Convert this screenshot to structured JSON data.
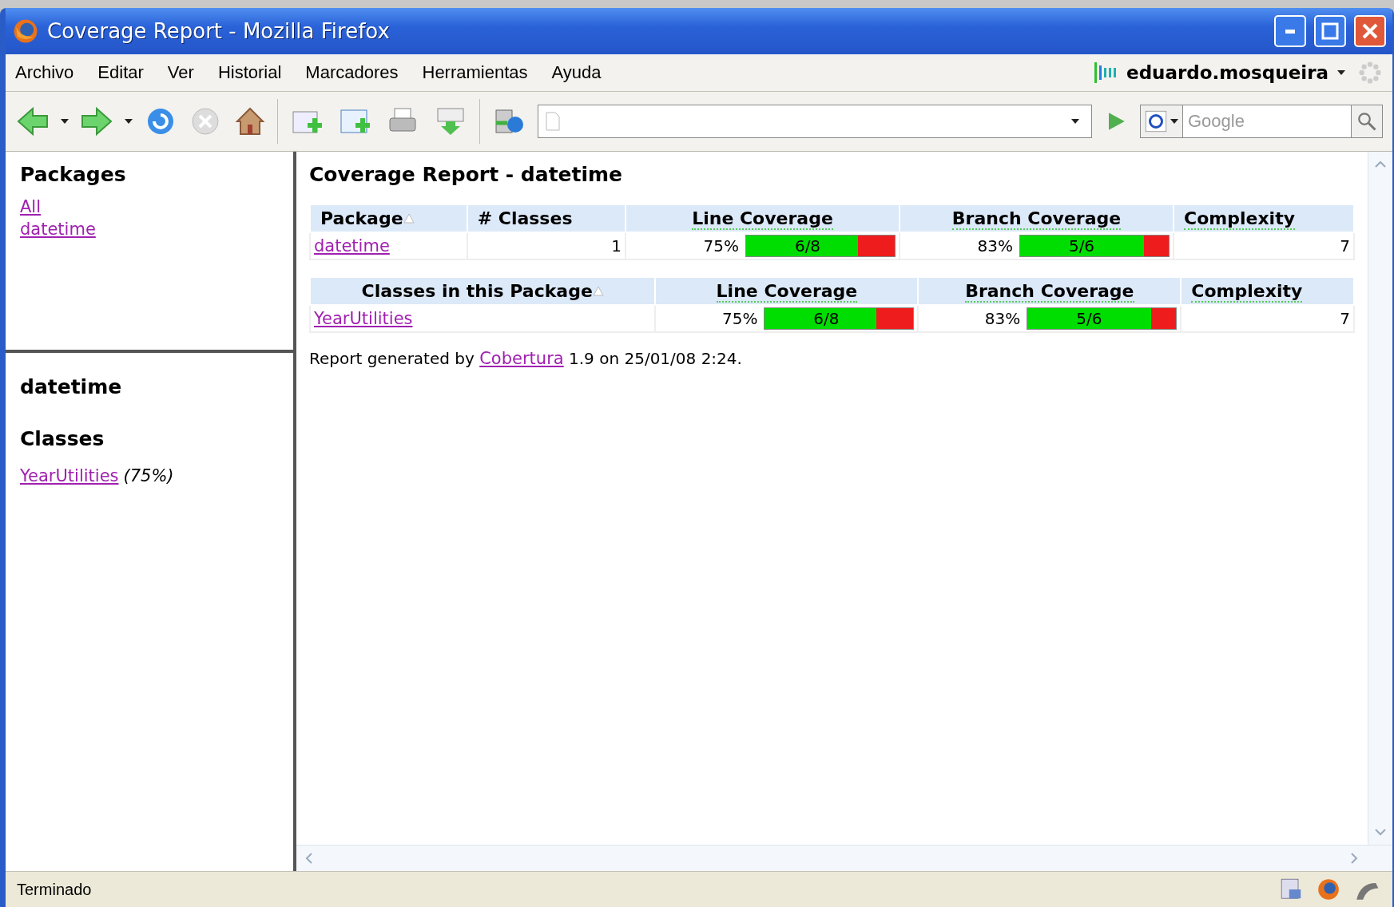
{
  "window": {
    "title": "Coverage Report - Mozilla Firefox"
  },
  "menu": [
    {
      "label": "Archivo"
    },
    {
      "label": "Editar"
    },
    {
      "label": "Ver"
    },
    {
      "label": "Historial"
    },
    {
      "label": "Marcadores"
    },
    {
      "label": "Herramientas"
    },
    {
      "label": "Ayuda"
    }
  ],
  "user": {
    "name": "eduardo.mosqueira"
  },
  "search": {
    "placeholder": "Google"
  },
  "packages_frame": {
    "heading": "Packages",
    "links": [
      "All",
      "datetime"
    ]
  },
  "package_frame": {
    "heading": "datetime",
    "subheading": "Classes",
    "classes": [
      {
        "name": "YearUtilities",
        "coverage": "(75%)"
      }
    ]
  },
  "report": {
    "title": "Coverage Report - datetime",
    "tables": [
      {
        "columns": [
          {
            "label": "Package",
            "sorted": true,
            "underlined": false
          },
          {
            "label": "# Classes",
            "sorted": false,
            "underlined": false
          },
          {
            "label": "Line Coverage",
            "sorted": false,
            "underlined": true
          },
          {
            "label": "Branch Coverage",
            "sorted": false,
            "underlined": true
          },
          {
            "label": "Complexity",
            "sorted": false,
            "underlined": true
          }
        ],
        "rows": [
          {
            "cells": [
              {
                "kind": "link",
                "text": "datetime"
              },
              {
                "kind": "number",
                "text": "1"
              },
              {
                "kind": "coverage",
                "percent": "75%",
                "level": 0.75,
                "label": "6/8"
              },
              {
                "kind": "coverage",
                "percent": "83%",
                "level": 0.833,
                "label": "5/6"
              },
              {
                "kind": "number",
                "text": "7"
              }
            ]
          }
        ]
      },
      {
        "columns": [
          {
            "label": "Classes in this Package",
            "sorted": true,
            "underlined": false
          },
          {
            "label": "Line Coverage",
            "sorted": false,
            "underlined": true
          },
          {
            "label": "Branch Coverage",
            "sorted": false,
            "underlined": true
          },
          {
            "label": "Complexity",
            "sorted": false,
            "underlined": true
          }
        ],
        "rows": [
          {
            "cells": [
              {
                "kind": "link",
                "text": "YearUtilities"
              },
              {
                "kind": "coverage",
                "percent": "75%",
                "level": 0.75,
                "label": "6/8"
              },
              {
                "kind": "coverage",
                "percent": "83%",
                "level": 0.833,
                "label": "5/6"
              },
              {
                "kind": "number",
                "text": "7"
              }
            ]
          }
        ]
      }
    ],
    "footer": {
      "before": "Report generated by ",
      "link": "Cobertura",
      "after": " 1.9 on 25/01/08 2:24."
    }
  },
  "status_bar": {
    "text": "Terminado"
  }
}
